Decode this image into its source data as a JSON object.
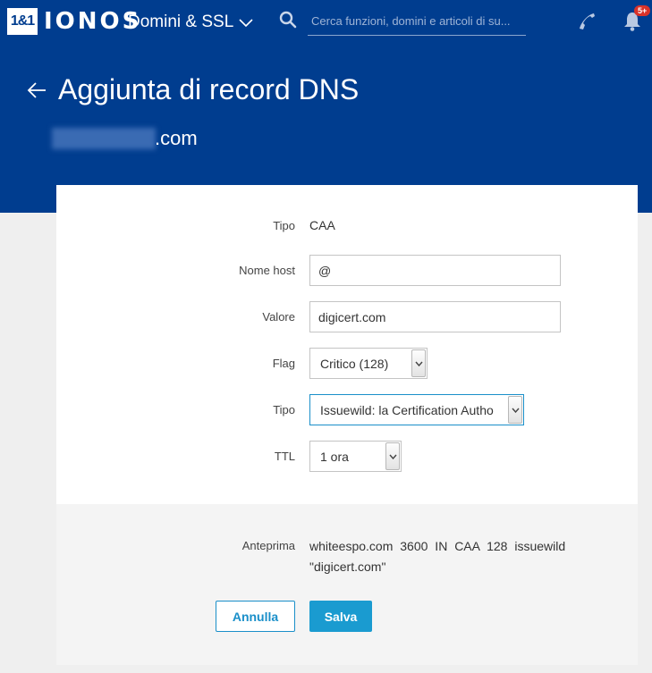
{
  "nav": {
    "logo_box": "1&1",
    "logo_text": "IONOS",
    "section": "Domini & SSL",
    "search_placeholder": "Cerca funzioni, domini e articoli di su...",
    "notifications_badge": "5+"
  },
  "header": {
    "title": "Aggiunta di record DNS",
    "domain_suffix": ".com"
  },
  "form": {
    "type_label": "Tipo",
    "type_value": "CAA",
    "host_label": "Nome host",
    "host_value": "@",
    "value_label": "Valore",
    "value_value": "digicert.com",
    "flag_label": "Flag",
    "flag_selected": "Critico (128)",
    "tag_label": "Tipo",
    "tag_selected": "Issuewild: la Certification Autho",
    "ttl_label": "TTL",
    "ttl_selected": "1 ora"
  },
  "preview": {
    "label": "Anteprima",
    "text": "whiteespo.com 3600 IN CAA 128 issuewild \"digicert.com\""
  },
  "actions": {
    "cancel_label": "Annulla",
    "save_label": "Salva"
  },
  "colors": {
    "brand_blue": "#003d8f",
    "accent": "#1a9bd0",
    "badge": "#d9332a"
  }
}
